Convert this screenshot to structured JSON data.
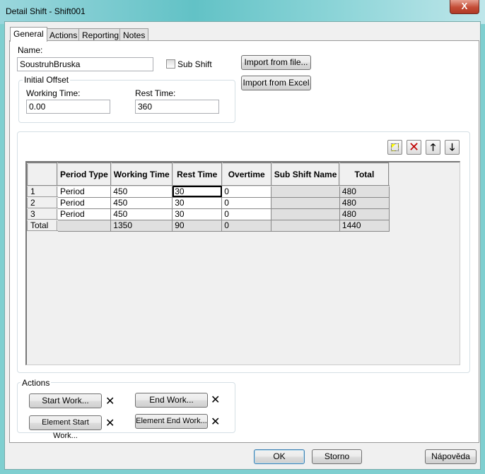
{
  "window": {
    "title": "Detail Shift - Shift001",
    "close_label": "X"
  },
  "tabs": [
    {
      "label": "General",
      "active": true
    },
    {
      "label": "Actions"
    },
    {
      "label": "Reporting"
    },
    {
      "label": "Notes"
    }
  ],
  "general": {
    "name_label": "Name:",
    "name_value": "SoustruhBruska",
    "sub_shift_label": "Sub Shift",
    "sub_shift_checked": false,
    "import_file": "Import from file...",
    "import_excel": "Import from Excel",
    "initial_offset": {
      "legend": "Initial Offset",
      "working_label": "Working Time:",
      "working_value": "0.00",
      "rest_label": "Rest Time:",
      "rest_value": "360"
    }
  },
  "toolbar": {
    "icons": [
      "new-row-icon",
      "delete-icon",
      "move-up-icon",
      "move-down-icon"
    ],
    "delete_color": "#c00000"
  },
  "grid": {
    "columns": [
      "Period Type",
      "Working Time",
      "Rest Time",
      "Overtime",
      "Sub Shift Name",
      "Total"
    ],
    "rows": [
      {
        "hdr": "1",
        "cells": [
          "Period",
          "450",
          "30",
          "0",
          "",
          "480"
        ]
      },
      {
        "hdr": "2",
        "cells": [
          "Period",
          "450",
          "30",
          "0",
          "",
          "480"
        ]
      },
      {
        "hdr": "3",
        "cells": [
          "Period",
          "450",
          "30",
          "0",
          "",
          "480"
        ]
      },
      {
        "hdr": "Total",
        "cells": [
          "",
          "1350",
          "90",
          "0",
          "",
          "1440"
        ]
      }
    ]
  },
  "actions": {
    "legend": "Actions",
    "start_work": "Start Work...",
    "end_work": "End Work...",
    "element_start_work": "Element Start Work...",
    "element_end_work": "Element End Work...",
    "clear": "✕"
  },
  "footer": {
    "ok": "OK",
    "cancel": "Storno",
    "help": "Nápověda"
  }
}
